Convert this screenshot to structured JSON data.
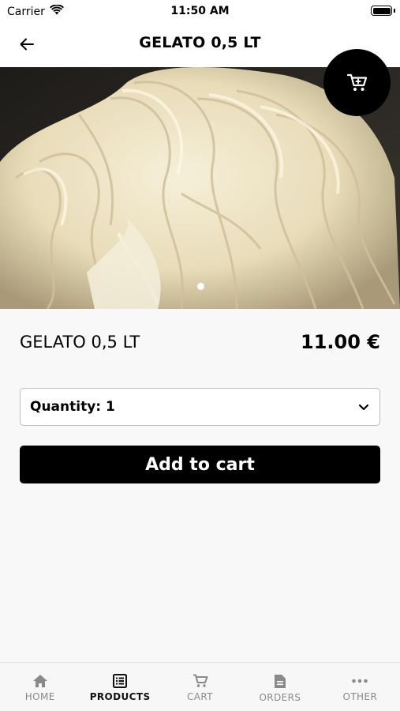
{
  "status": {
    "carrier": "Carrier",
    "time": "11:50 AM"
  },
  "header": {
    "title": "GELATO 0,5 LT",
    "back_icon": "arrow-left-icon"
  },
  "hero": {
    "image_subject": "soft-serve gelato swirl",
    "carousel_pages": 1,
    "carousel_active": 1
  },
  "cart_fab": {
    "icon": "cart-icon"
  },
  "product": {
    "name": "GELATO 0,5 LT",
    "price": "11.00 €"
  },
  "quantity": {
    "label": "Quantity: 1",
    "selected": "1"
  },
  "actions": {
    "add_to_cart": "Add to cart"
  },
  "tabs": [
    {
      "label": "HOME",
      "icon": "home-icon",
      "active": false
    },
    {
      "label": "PRODUCTS",
      "icon": "list-icon",
      "active": true
    },
    {
      "label": "CART",
      "icon": "cart-icon",
      "active": false
    },
    {
      "label": "ORDERS",
      "icon": "document-icon",
      "active": false
    },
    {
      "label": "OTHER",
      "icon": "more-icon",
      "active": false
    }
  ],
  "colors": {
    "accent": "#000000",
    "background": "#f8f8f8",
    "tab_inactive": "#8a8a8a"
  }
}
